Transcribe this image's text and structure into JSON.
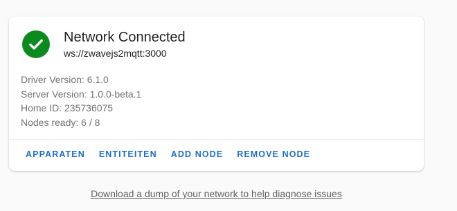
{
  "status": {
    "title": "Network Connected",
    "url": "ws://zwavejs2mqtt:3000",
    "icon": "check-circle-icon",
    "icon_color": "#0b8a1e"
  },
  "info": {
    "driver_version": "Driver Version: 6.1.0",
    "server_version": "Server Version: 1.0.0-beta.1",
    "home_id": "Home ID: 235736075",
    "nodes_ready": "Nodes ready: 6 / 8"
  },
  "actions": {
    "apparaten": "APPARATEN",
    "entiteiten": "ENTITEITEN",
    "add_node": "ADD NODE",
    "remove_node": "REMOVE NODE"
  },
  "footer": {
    "dump_link": "Download a dump of your network to help diagnose issues"
  },
  "colors": {
    "accent": "#1e6ec8",
    "success": "#0b8a1e"
  }
}
